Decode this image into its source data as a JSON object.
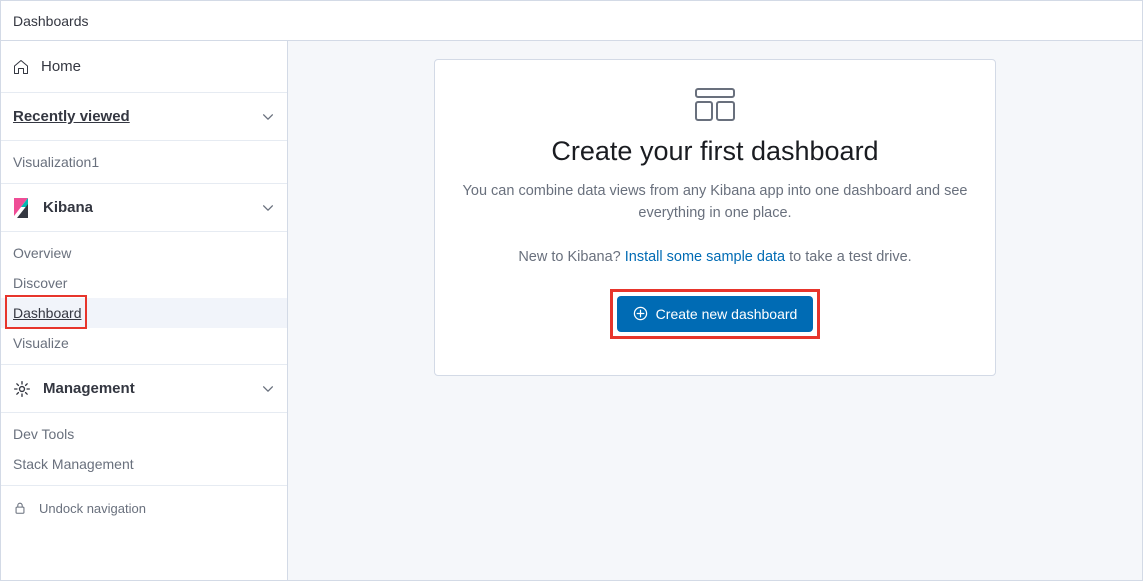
{
  "topbar": {
    "breadcrumb": "Dashboards"
  },
  "sidebar": {
    "home": "Home",
    "recently": {
      "title": "Recently viewed",
      "items": [
        "Visualization1"
      ]
    },
    "kibana": {
      "title": "Kibana",
      "items": [
        "Overview",
        "Discover",
        "Dashboard",
        "Visualize"
      ]
    },
    "management": {
      "title": "Management",
      "items": [
        "Dev Tools",
        "Stack Management"
      ]
    },
    "undock": "Undock navigation"
  },
  "main": {
    "title": "Create your first dashboard",
    "description": "You can combine data views from any Kibana app into one dashboard and see everything in one place.",
    "sub_pre": "New to Kibana? ",
    "sub_link": "Install some sample data",
    "sub_post": " to take a test drive.",
    "button": "Create new dashboard"
  }
}
